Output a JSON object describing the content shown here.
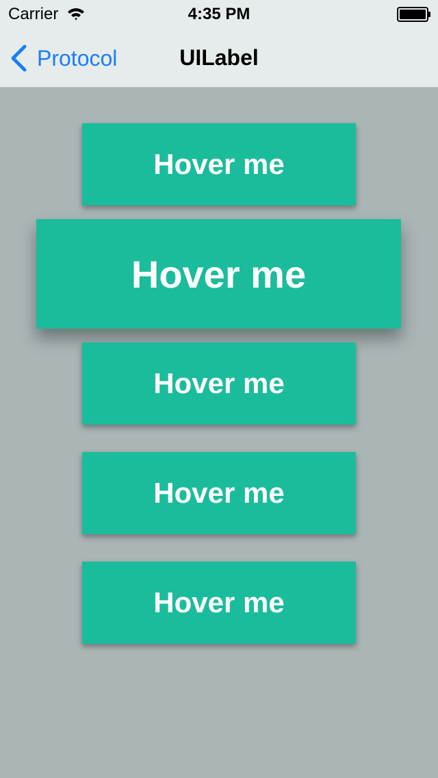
{
  "status_bar": {
    "carrier": "Carrier",
    "time": "4:35 PM",
    "wifi_icon": "wifi-icon",
    "battery_icon": "battery-full-icon"
  },
  "nav_bar": {
    "back_label": "Protocol",
    "back_icon": "chevron-left-icon",
    "title": "UILabel"
  },
  "buttons": [
    {
      "label": "Hover me",
      "state": "normal"
    },
    {
      "label": "Hover me",
      "state": "hovered"
    },
    {
      "label": "Hover me",
      "state": "normal"
    },
    {
      "label": "Hover me",
      "state": "normal"
    },
    {
      "label": "Hover me",
      "state": "normal"
    }
  ],
  "colors": {
    "background": "#aab5b6",
    "nav_background": "#e6ebec",
    "accent": "#1a7ef7",
    "button": "#1bbc9b",
    "button_text": "#ffffff"
  }
}
